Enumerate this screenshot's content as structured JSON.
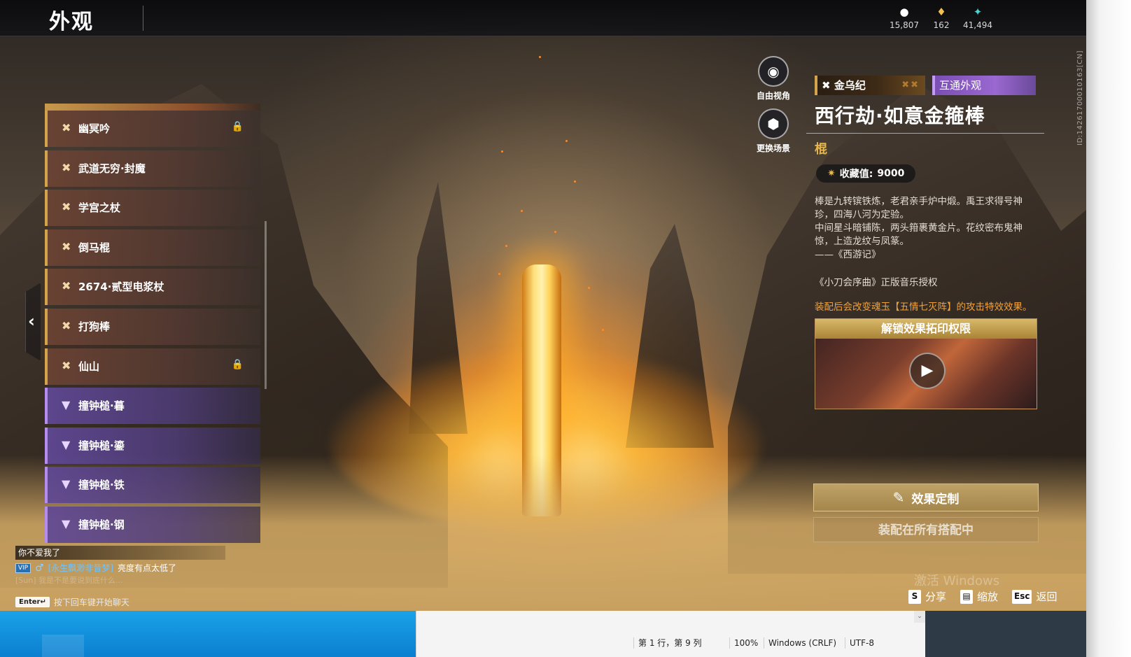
{
  "header": {
    "title": "外观",
    "currencies": [
      {
        "icon": "coin-icon",
        "value": "15,807"
      },
      {
        "icon": "ticket-icon",
        "value": "162"
      },
      {
        "icon": "feather-icon",
        "value": "41,494"
      }
    ]
  },
  "side_buttons": {
    "free_view": "自由视角",
    "change_scene": "更换场景"
  },
  "list": {
    "items": [
      {
        "label": "幽冥吟",
        "rarity": "gold",
        "locked": true
      },
      {
        "label": "武道无穷·封魔",
        "rarity": "gold",
        "locked": false
      },
      {
        "label": "学宫之杖",
        "rarity": "gold",
        "locked": false
      },
      {
        "label": "倒马棍",
        "rarity": "gold",
        "locked": false
      },
      {
        "label": "2674·贰型电浆杖",
        "rarity": "gold",
        "locked": false
      },
      {
        "label": "打狗棒",
        "rarity": "gold",
        "locked": false
      },
      {
        "label": "仙山",
        "rarity": "gold",
        "locked": true
      },
      {
        "label": "撞钟槌·暮",
        "rarity": "purple",
        "locked": false
      },
      {
        "label": "撞钟槌·鎏",
        "rarity": "purple",
        "locked": false
      },
      {
        "label": "撞钟槌·铁",
        "rarity": "purple",
        "locked": false
      },
      {
        "label": "撞钟槌·钢",
        "rarity": "purple",
        "locked": false
      }
    ]
  },
  "chat": {
    "line1": "你不爱我了",
    "badge": "VIP",
    "sender": "[永生飘渺非昔梦]",
    "message": "亮度有点太低了",
    "faded": "[Sun] 我是不是要说到底什么...",
    "enter_key": "Enter↵",
    "hint": "按下回车键开始聊天"
  },
  "detail": {
    "series_tag": "金乌纪",
    "shared_tag": "互通外观",
    "name": "西行劫·如意金箍棒",
    "type": "棍",
    "collect_label": "收藏值:",
    "collect_value": "9000",
    "desc_lines": [
      "棒是九转镔铁炼，老君亲手炉中煅。禹王求得号神珍，四海八河为定验。",
      "中间星斗暗铺陈，两头箝裹黄金片。花纹密布鬼神惊，上造龙纹与凤篆。",
      "——《西游记》"
    ],
    "license": "《小刀会序曲》正版音乐授权",
    "effect": "装配后会改变魂玉【五情七灭阵】的攻击特效效果。",
    "unlock_label": "解锁效果拓印权限",
    "custom_label": "效果定制",
    "equipped_label": "装配在所有搭配中",
    "version_id": "ID:1426170001016​3[CN]"
  },
  "watermark": "激活 Windows",
  "hints": [
    {
      "key": "S",
      "label": "分享"
    },
    {
      "key": "",
      "label": "缩放"
    },
    {
      "key": "Esc",
      "label": "返回"
    }
  ],
  "notepad": {
    "position": "第 1 行，第 9 列",
    "zoom": "100%",
    "eol": "Windows (CRLF)",
    "encoding": "UTF-8"
  }
}
